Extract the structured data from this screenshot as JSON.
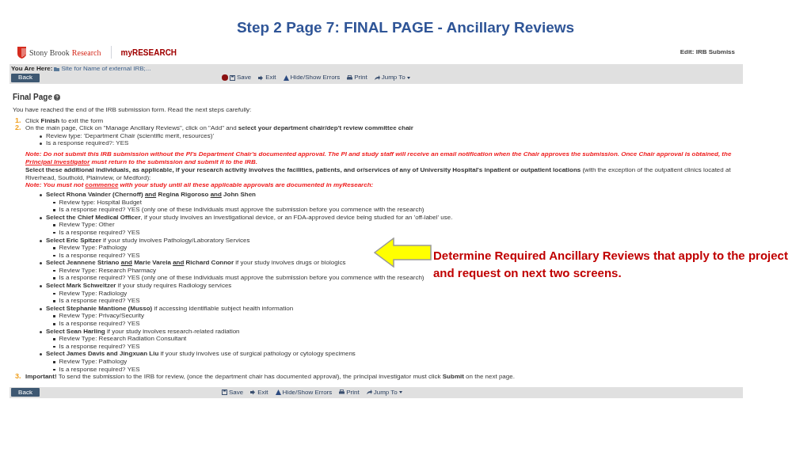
{
  "slide_title": "Step 2 Page 7: FINAL PAGE - Ancillary Reviews",
  "header": {
    "brand_name": "Stony Brook",
    "brand_accent": "Research",
    "app_name": "myRESEARCH",
    "edit_label": "Edit: IRB Submiss"
  },
  "breadcrumb": {
    "label": "You Are Here:",
    "link": "Site for Name of external IRB;..."
  },
  "toolbar_top": {
    "back": "Back",
    "actions": [
      {
        "kind": "save",
        "label": "Save"
      },
      {
        "kind": "exit",
        "label": "Exit"
      },
      {
        "kind": "errors",
        "label": "Hide/Show Errors"
      },
      {
        "kind": "print",
        "label": "Print"
      },
      {
        "kind": "jump",
        "label": "Jump To"
      }
    ]
  },
  "page_title": "Final Page",
  "intro": "You have reached the end of the IRB submission form. Read the next steps carefully:",
  "steps": [
    {
      "number": "1.",
      "text": "Click **Finish** to exit the form"
    },
    {
      "number": "2.",
      "text": "On the main page, Click on \"Manage Ancillary Reviews\", click on \"Add\" and **select your department chair/dep't review committee chair**",
      "bullets": [
        "Review type: 'Department Chair (scientific merit, resources)'",
        "Is a response required?: YES"
      ],
      "note": [
        {
          "text": "Note: Do not submit this IRB submission without the PI's Department Chair's documented approval. The PI and study staff will receive an email notification when the Chair approves the submission. Once Chair approval is obtained, the ",
          "underline": false
        },
        {
          "text": "Principal Investigator",
          "underline": true
        },
        {
          "text": " must return to the submission and submit it to the IRB.",
          "underline": false
        }
      ],
      "instruction": "**Select these additional individuals, as applicable, if your research activity involves the facilities, patients, and or/services of any of University Hospital's inpatient or outpatient locations** (with the exception of the outpatient clinics located at Riverhead, Southold, Plainview, or Medford):",
      "warning": [
        {
          "text": "Note: You must not ",
          "underline": false
        },
        {
          "text": "commence",
          "underline": true
        },
        {
          "text": " with your study until all these applicable approvals are documented in myResearch:",
          "underline": false
        }
      ],
      "reviewers": [
        {
          "text": [
            {
              "text": "**Select Rhona Vainder (Chernoff)** ",
              "underline": false
            },
            {
              "text": "**and**",
              "underline": true
            },
            {
              "text": " **Regina Rigoroso** ",
              "underline": false
            },
            {
              "text": "**and**",
              "underline": true
            },
            {
              "text": " **John Shen**",
              "underline": false
            }
          ],
          "details": [
            "Review type: Hospital Budget",
            "Is a response required? YES (only one of these individuals must approve the submission before you commence with the research)"
          ]
        },
        {
          "text": "**Select the Chief Medical Officer**, if your study involves an investigational device, or an FDA-approved device being studied for an 'off-label' use.",
          "details": [
            "Review Type: Other",
            "Is a response required? YES"
          ]
        },
        {
          "text": "**Select Eric Spitzer** if your study involves Pathology/Laboratory Services",
          "details": [
            "Review Type: Pathology",
            "Is a response required? YES"
          ]
        },
        {
          "text": [
            {
              "text": "**Select Jeannene Striano** ",
              "underline": false
            },
            {
              "text": "**and**",
              "underline": true
            },
            {
              "text": " **Marie Varela** ",
              "underline": false
            },
            {
              "text": "**and**",
              "underline": true
            },
            {
              "text": " **Richard Connor** if your study involves drugs or biologics",
              "underline": false
            }
          ],
          "details": [
            "Review Type: Research Pharmacy",
            "Is a response required? YES (only one of these individuals must approve the submission before you commence with the research)"
          ]
        },
        {
          "text": "**Select Mark Schweitzer** if your study requires Radiology services",
          "details": [
            "Review Type: Radiology",
            "Is a response required? YES"
          ]
        },
        {
          "text": "**Select Stephanie Mantione (Musso)** if accessing identifiable subject health information",
          "details": [
            "Review Type: Privacy/Security",
            "Is a response required? YES"
          ]
        },
        {
          "text": "**Select Sean Harling** if your study involves research-related radiation",
          "details": [
            "Review Type: Research Radiation Consultant",
            "Is a response required? YES"
          ]
        },
        {
          "text": "**Select James Davis and Jingxuan Liu** if your study involves use of surgical pathology or cytology specimens",
          "details": [
            "Review Type: Pathology",
            "Is a response required? YES"
          ]
        }
      ]
    },
    {
      "number": "3.",
      "text": "**Important!** To send the submission to the IRB for review, (once the department chair has documented approval), the principal investigator must click **Submit** on the next page."
    }
  ],
  "toolbar_bottom": {
    "back": "Back",
    "actions": [
      {
        "kind": "save",
        "label": "Save"
      },
      {
        "kind": "exit",
        "label": "Exit"
      },
      {
        "kind": "errors",
        "label": "Hide/Show Errors"
      },
      {
        "kind": "print",
        "label": "Print"
      },
      {
        "kind": "jump",
        "label": "Jump To"
      }
    ]
  },
  "callout": "Determine Required Ancillary Reviews that apply to the project and request on next two screens."
}
